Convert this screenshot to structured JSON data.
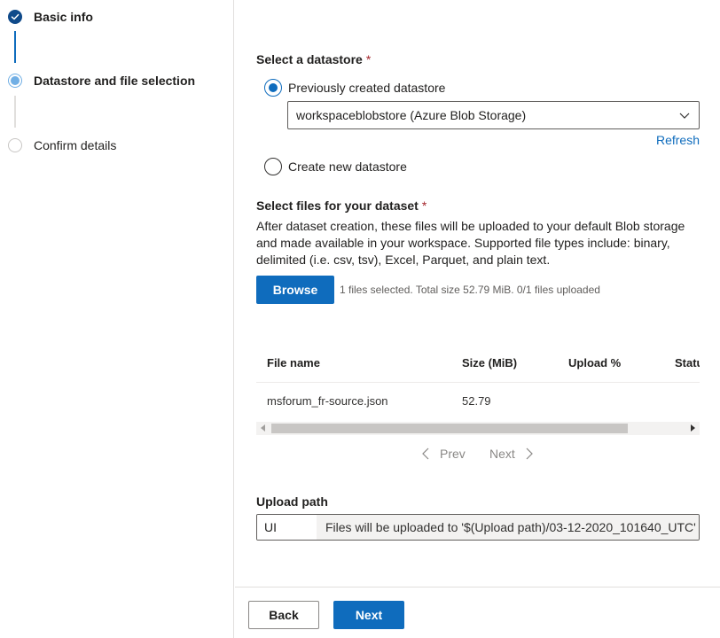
{
  "steps": [
    {
      "label": "Basic info",
      "state": "done"
    },
    {
      "label": "Datastore and file selection",
      "state": "active"
    },
    {
      "label": "Confirm details",
      "state": "todo"
    }
  ],
  "datastore": {
    "title": "Select a datastore",
    "required_mark": "*",
    "option_previous": "Previously created datastore",
    "selected_value": "workspaceblobstore (Azure Blob Storage)",
    "refresh_label": "Refresh",
    "option_new": "Create new datastore"
  },
  "files": {
    "title": "Select files for your dataset",
    "required_mark": "*",
    "description": "After dataset creation, these files will be uploaded to your default Blob storage and made available in your workspace. Supported file types include: binary, delimited (i.e. csv, tsv), Excel, Parquet, and plain text.",
    "browse_label": "Browse",
    "status_text": "1 files selected. Total size 52.79 MiB. 0/1 files uploaded"
  },
  "table": {
    "columns": [
      "File name",
      "Size (MiB)",
      "Upload %",
      "Status"
    ],
    "rows": [
      {
        "file_name": "msforum_fr-source.json",
        "size": "52.79",
        "upload": "",
        "status": ""
      }
    ]
  },
  "pager": {
    "prev_label": "Prev",
    "next_label": "Next"
  },
  "upload_path": {
    "title": "Upload path",
    "value": "UI",
    "suffix": "Files will be uploaded to '$(Upload path)/03-12-2020_101640_UTC'"
  },
  "footer": {
    "back_label": "Back",
    "next_label": "Next"
  },
  "colors": {
    "accent": "#0f6cbd",
    "required": "#a4262c",
    "done_step": "#0f4a8a",
    "active_step": "#71afe5"
  }
}
